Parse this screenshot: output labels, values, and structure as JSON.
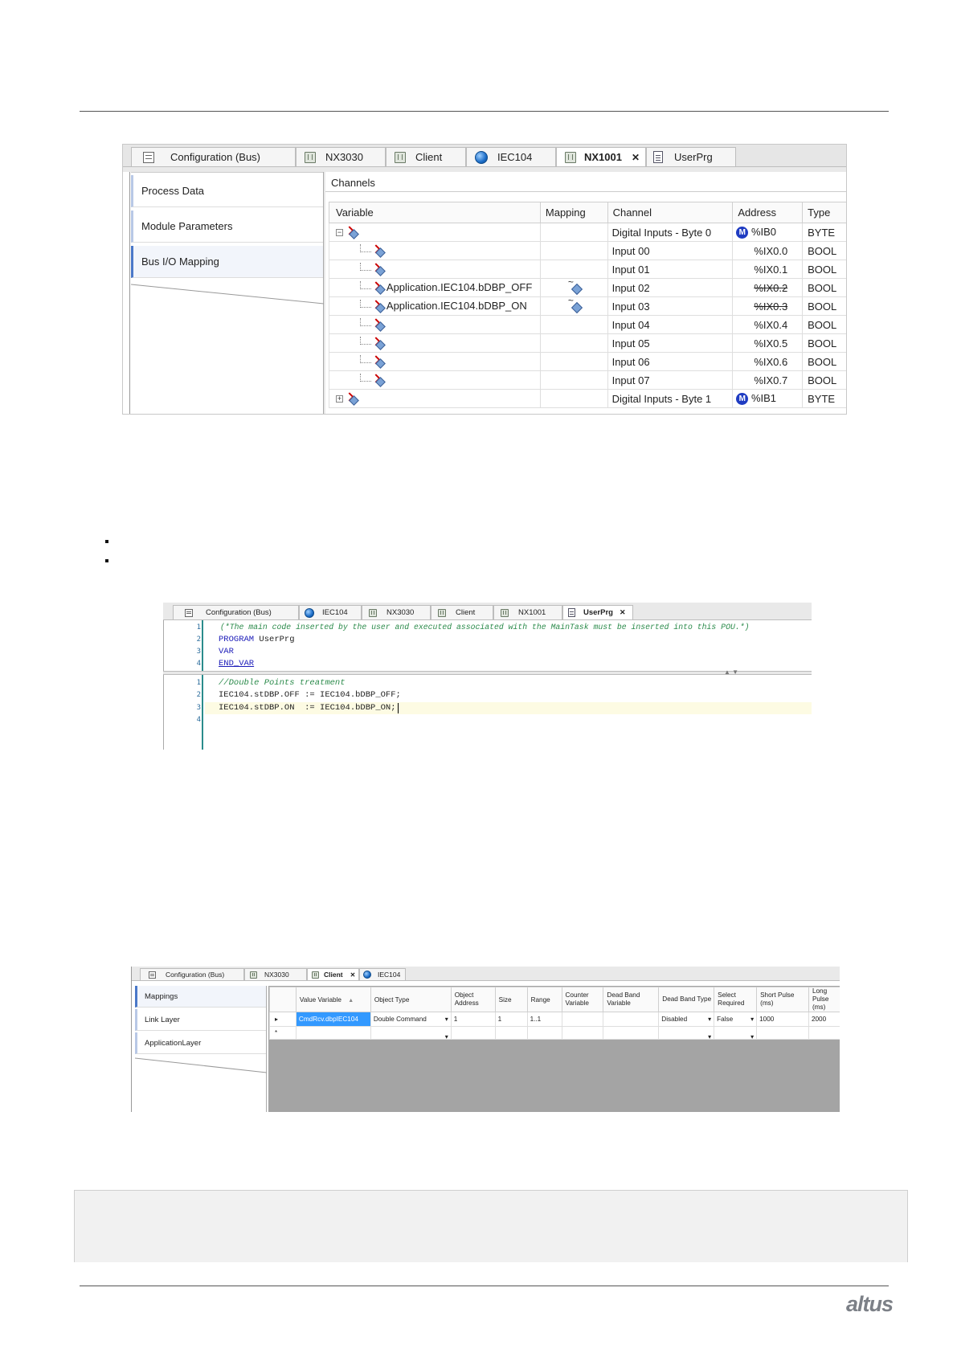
{
  "figure1": {
    "tabs": [
      {
        "label": "Configuration (Bus)",
        "icon": "config-icon"
      },
      {
        "label": "NX3030",
        "icon": "device-icon"
      },
      {
        "label": "Client",
        "icon": "device-icon"
      },
      {
        "label": "IEC104",
        "icon": "globe-icon"
      },
      {
        "label": "NX1001",
        "icon": "device-icon",
        "active": true,
        "close": "✕"
      },
      {
        "label": "UserPrg",
        "icon": "document-icon"
      }
    ],
    "nav": [
      "Process Data",
      "Module Parameters",
      "Bus I/O Mapping"
    ],
    "channels_title": "Channels",
    "columns": [
      "Variable",
      "Mapping",
      "Channel",
      "Address",
      "Type"
    ],
    "rows": [
      {
        "variable": "",
        "channel": "Digital Inputs - Byte 0",
        "address": "%IB0",
        "type": "BYTE",
        "expander": "−",
        "m_badge": "M"
      },
      {
        "variable": "",
        "channel": "Input 00",
        "address": "%IX0.0",
        "type": "BOOL"
      },
      {
        "variable": "",
        "channel": "Input 01",
        "address": "%IX0.1",
        "type": "BOOL"
      },
      {
        "variable": "Application.IEC104.bDBP_OFF",
        "channel": "Input 02",
        "address": "%IX0.2",
        "type": "BOOL",
        "mapped": true,
        "struck": true
      },
      {
        "variable": "Application.IEC104.bDBP_ON",
        "channel": "Input 03",
        "address": "%IX0.3",
        "type": "BOOL",
        "mapped": true,
        "struck": true
      },
      {
        "variable": "",
        "channel": "Input 04",
        "address": "%IX0.4",
        "type": "BOOL"
      },
      {
        "variable": "",
        "channel": "Input 05",
        "address": "%IX0.5",
        "type": "BOOL"
      },
      {
        "variable": "",
        "channel": "Input 06",
        "address": "%IX0.6",
        "type": "BOOL"
      },
      {
        "variable": "",
        "channel": "Input 07",
        "address": "%IX0.7",
        "type": "BOOL"
      },
      {
        "variable": "",
        "channel": "Digital Inputs - Byte 1",
        "address": "%IB1",
        "type": "BYTE",
        "expander": "+",
        "m_badge": "M"
      }
    ]
  },
  "figure2": {
    "tabs": [
      {
        "label": "Configuration (Bus)",
        "icon": "config-icon"
      },
      {
        "label": "IEC104",
        "icon": "globe-icon"
      },
      {
        "label": "NX3030",
        "icon": "device-icon"
      },
      {
        "label": "Client",
        "icon": "device-icon"
      },
      {
        "label": "NX1001",
        "icon": "device-icon"
      },
      {
        "label": "UserPrg",
        "icon": "document-icon",
        "active": true,
        "close": "✕"
      }
    ],
    "decl_lines": [
      {
        "n": "1",
        "text": "(*The main code inserted by the user and executed associated with the MainTask must be inserted into this POU.*)",
        "kind": "comment"
      },
      {
        "n": "2",
        "kw": "PROGRAM",
        "text": " UserPrg"
      },
      {
        "n": "3",
        "kw": "VAR",
        "text": ""
      },
      {
        "n": "4",
        "kw": "END_VAR",
        "text": ""
      }
    ],
    "impl_lines": [
      {
        "n": "1",
        "text": "//Double Points treatment",
        "kind": "comment"
      },
      {
        "n": "2",
        "text": "IEC104.stDBP.OFF := IEC104.bDBP_OFF;"
      },
      {
        "n": "3",
        "text": "IEC104.stDBP.ON  := IEC104.bDBP_ON;"
      },
      {
        "n": "4",
        "text": ""
      }
    ]
  },
  "figure3": {
    "tabs": [
      {
        "label": "Configuration (Bus)",
        "icon": "config-icon"
      },
      {
        "label": "NX3030",
        "icon": "device-icon"
      },
      {
        "label": "Client",
        "icon": "device-icon",
        "active": true,
        "close": "✕"
      },
      {
        "label": "IEC104",
        "icon": "globe-icon"
      }
    ],
    "nav": [
      "Mappings",
      "Link Layer",
      "ApplicationLayer"
    ],
    "columns": [
      "Value Variable",
      "Object Type",
      "Object Address",
      "Size",
      "Range",
      "Counter Variable",
      "Dead Band Variable",
      "Dead Band Type",
      "Select Required",
      "Short Pulse (ms)",
      "Long Pulse (ms)"
    ],
    "sort_indicator": "▲",
    "row1": {
      "marker": "▸",
      "value_variable": "CmdRcv.dbpIEC104",
      "object_type": "Double Command",
      "object_address": "1",
      "size": "1",
      "range": "1..1",
      "counter_variable": "",
      "dead_band_variable": "",
      "dead_band_type": "Disabled",
      "select_required": "False",
      "short_pulse": "1000",
      "long_pulse": "2000"
    },
    "row2_marker": "*",
    "dropdown_glyph": "▾"
  },
  "footer": {
    "logo": "altus"
  },
  "colors": {
    "selection": "#3399ff",
    "highlight_line": "#fdfbe3",
    "gray_area": "#a4a4a4",
    "accent_nav": "#4a78c8"
  }
}
